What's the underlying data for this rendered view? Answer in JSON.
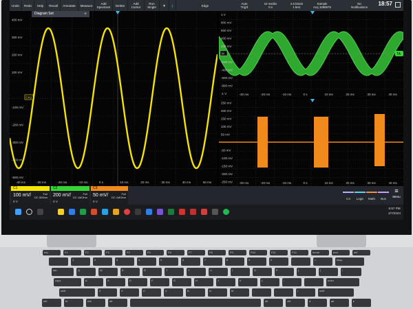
{
  "toolbar": {
    "buttons": [
      "Undo",
      "Redo",
      "Help",
      "Recall",
      "Annotate",
      "Measure",
      "Add\nSpectrum",
      "Delete",
      "Add\nCursor",
      "Run\nSingle"
    ],
    "status": [
      {
        "label": "Edge",
        "value": ""
      },
      {
        "label": "Auto",
        "value": "Trig'd"
      },
      {
        "label": "10 ms/div",
        "value": "0 s"
      },
      {
        "label": "2.5 kSa/s",
        "value": "1 kHz"
      },
      {
        "label": "Sample",
        "value": "Acq 1068575"
      },
      {
        "label": "No",
        "value": "Notifications"
      }
    ],
    "clock": "18:57"
  },
  "diagram_tab": {
    "label": "Diagram Set",
    "plus": "+"
  },
  "left_panel": {
    "y_ticks": [
      "400 mV",
      "300 mV",
      "200 mV",
      "100 mV",
      "",
      "-100 mV",
      "-200 mV",
      "-300 mV",
      "-400 mV",
      "-500 mV"
    ],
    "x_ticks": [
      "-40 ms",
      "-30 ms",
      "-20 ms",
      "-10 ms",
      "0 s",
      "10 ms",
      "20 ms",
      "30 ms",
      "40 ms",
      "50 ms"
    ],
    "ref_marker": "CH1"
  },
  "right_top": {
    "y_ticks": [
      "1 V",
      "800 mV",
      "600 mV",
      "400 mV",
      "200 mV",
      "",
      "-200 mV",
      "-400 mV",
      "-600 mV",
      "-800 mV",
      "-1 V"
    ],
    "x_ticks": [
      "-30 ms",
      "-20 ms",
      "-10 ms",
      "0 s",
      "10 ms",
      "20 ms",
      "30 ms",
      "40 ms"
    ],
    "ref_marker": "M",
    "ta_marker": "TA"
  },
  "right_bottom": {
    "y_ticks": [
      "250 mV",
      "200 mV",
      "150 mV",
      "100 mV",
      "50 mV",
      "",
      "-50 mV",
      "-100 mV",
      "-150 mV",
      "-200 mV",
      "-250 mV"
    ],
    "x_ticks": [
      "-30 ms",
      "-20 ms",
      "-10 ms",
      "0 s",
      "10 ms",
      "20 ms",
      "30 ms",
      "40 ms"
    ]
  },
  "channels": [
    {
      "name": "C1",
      "scale": "100 mV/",
      "coupling": "Full\nDC 500hm",
      "offset": "0 V",
      "color": "#f5e400"
    },
    {
      "name": "C2",
      "scale": "200 mV/",
      "coupling": "Full\nDC 1MOhm",
      "offset": "0 V",
      "color": "#37d437"
    },
    {
      "name": "C3",
      "scale": "50 mV/",
      "coupling": "Full\nDC 1MOhm",
      "offset": "0 V",
      "color": "#f08a1c"
    }
  ],
  "add_buttons": [
    "C4",
    "Logic",
    "Math",
    "Bus"
  ],
  "menu_label": "Menu",
  "taskbar": {
    "time": "6:57 PM",
    "date": "2/7/2024"
  },
  "colors": {
    "ch1": "#f5e400",
    "ch2": "#37d437",
    "ch3": "#f08a1c",
    "trigger": "#3fb8e8",
    "grid": "#3a3a3a"
  }
}
